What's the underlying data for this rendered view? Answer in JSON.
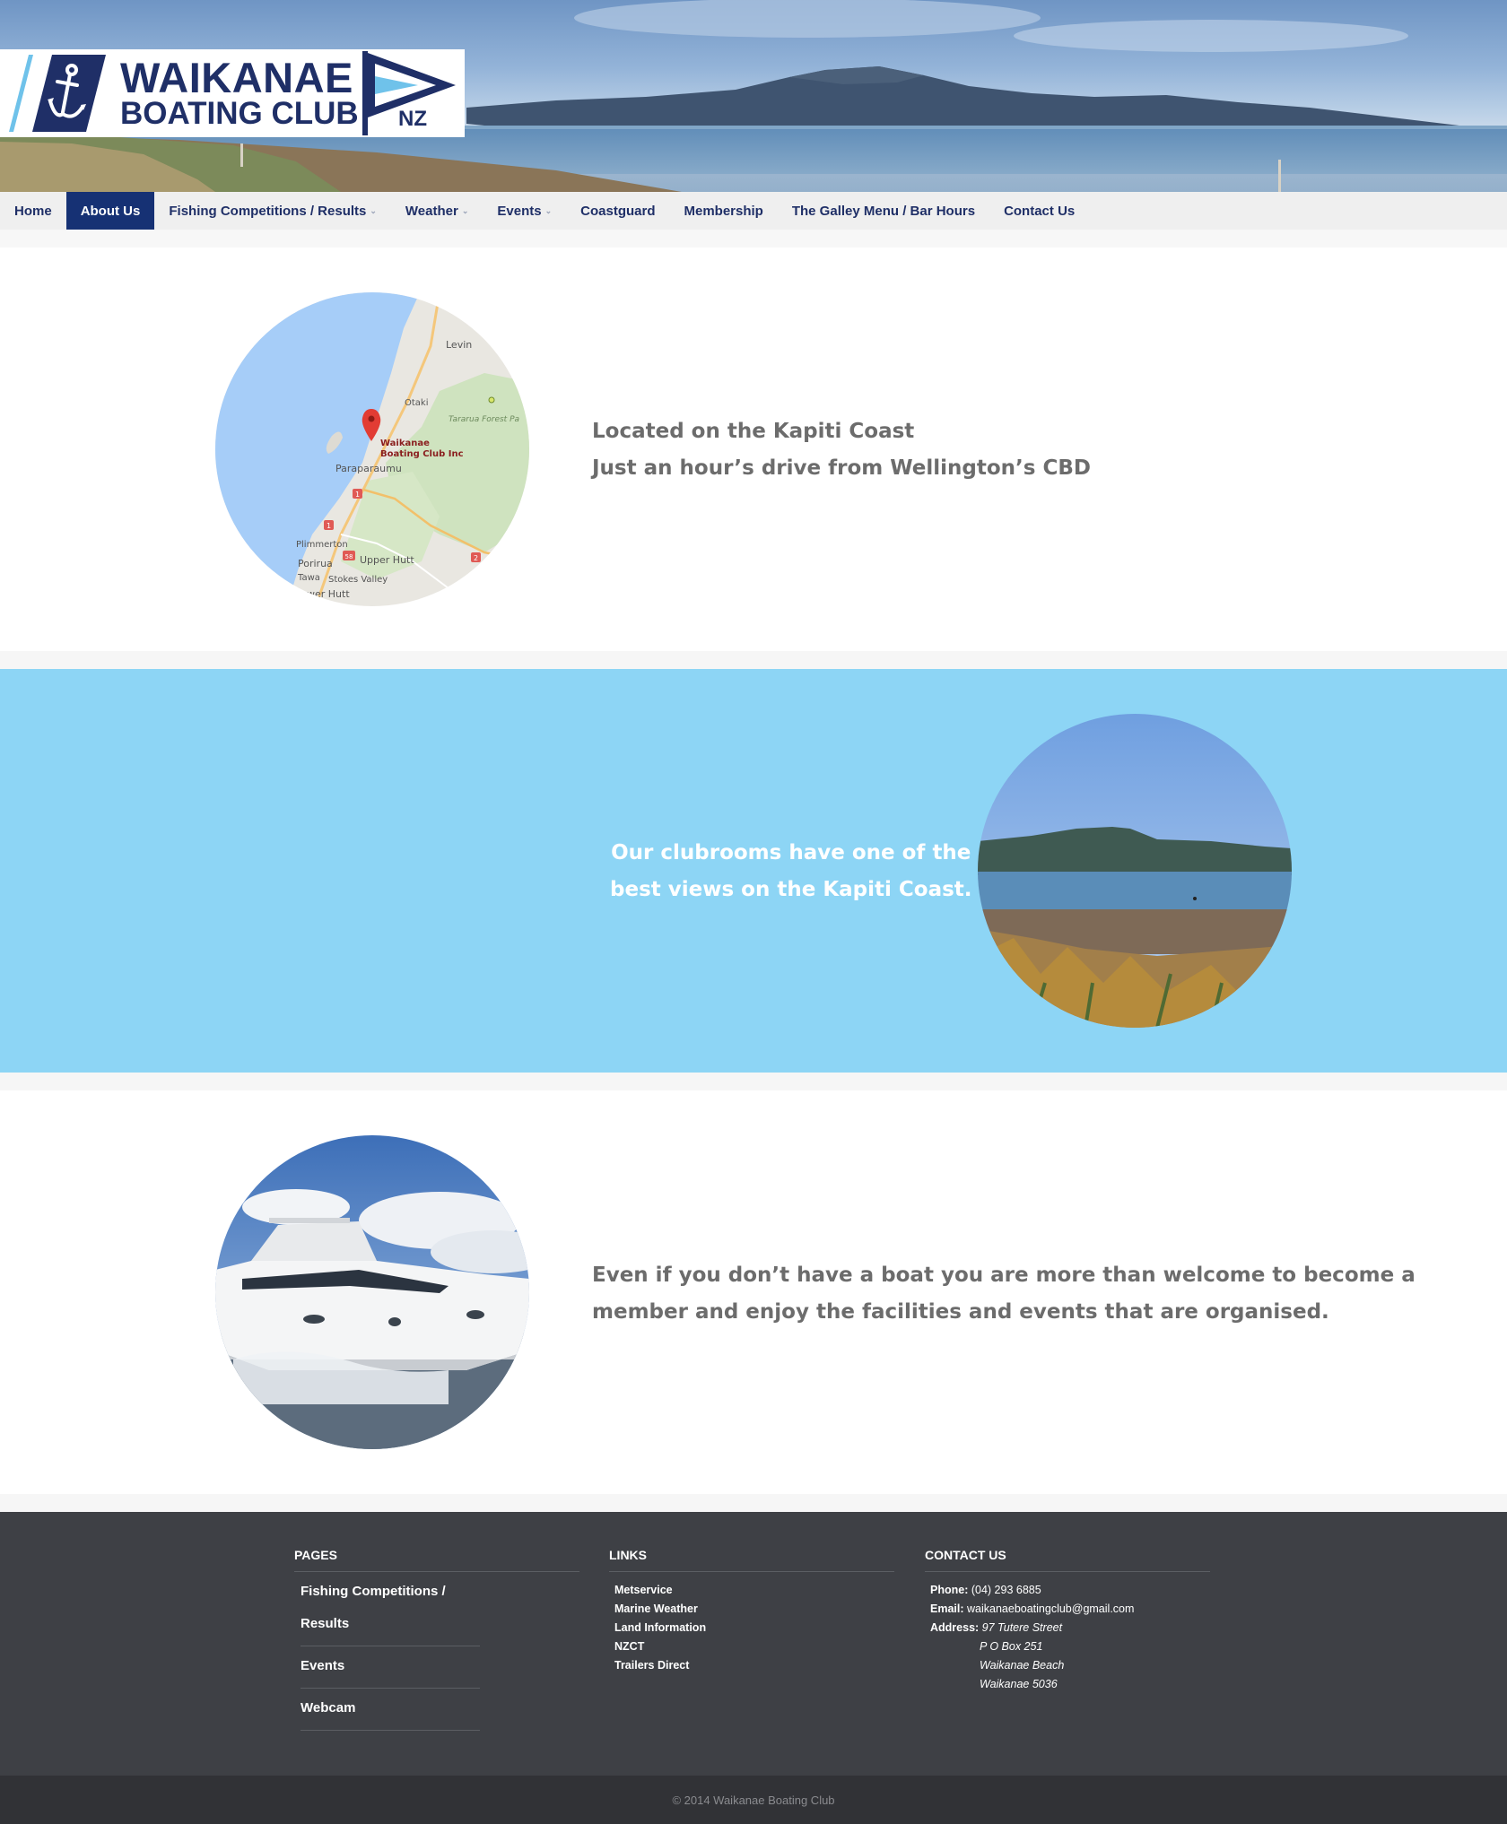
{
  "header": {
    "logo_line1": "WAIKANAE",
    "logo_line2": "BOATING CLUB",
    "logo_nz": "NZ"
  },
  "nav": {
    "items": [
      {
        "label": "Home"
      },
      {
        "label": "About Us",
        "active": true
      },
      {
        "label": "Fishing Competitions / Results",
        "caret": "⌄"
      },
      {
        "label": "Weather",
        "caret": "⌄"
      },
      {
        "label": "Events",
        "caret": "⌄"
      },
      {
        "label": "Coastguard"
      },
      {
        "label": "Membership"
      },
      {
        "label": "The Galley Menu / Bar Hours"
      },
      {
        "label": "Contact Us"
      }
    ]
  },
  "map": {
    "labels": [
      "Levin",
      "Otaki",
      "Tararua Forest Pa",
      "Waikanae",
      "Boating Club Inc",
      "Paraparaumu",
      "Plimmerton",
      "Porirua",
      "Upper Hutt",
      "Tawa",
      "Stokes Valley",
      "wer Hutt"
    ],
    "shields": [
      "1",
      "1",
      "58",
      "2"
    ]
  },
  "sections": {
    "s1": {
      "line1": "Located on the Kapiti Coast",
      "line2": "Just an hour’s drive from Wellington’s CBD"
    },
    "s2": {
      "line1": "Our clubrooms have one of the",
      "line2": "best views on the Kapiti Coast."
    },
    "s3": {
      "line1": "Even if you don’t have a boat you are more than welcome to become a",
      "line2": "member and enjoy the facilities and events that are organised."
    }
  },
  "colors": {
    "brand_navy": "#1f2f67",
    "nav_active": "#163174",
    "band_blue": "#8dd5f5",
    "footer_bg": "#3e4045"
  },
  "footer": {
    "pages": {
      "heading": "PAGES",
      "items": [
        "Fishing Competitions / Results",
        "Events",
        "Webcam"
      ]
    },
    "links": {
      "heading": "LINKS",
      "items": [
        "Metservice",
        "Marine Weather",
        "Land Information",
        "NZCT",
        "Trailers Direct"
      ]
    },
    "contact": {
      "heading": "CONTACT US",
      "phone_label": "Phone:",
      "phone": "(04) 293 6885",
      "email_label": "Email:",
      "email": "waikanaeboatingclub@gmail.com",
      "address_label": "Address:",
      "address": [
        "97 Tutere Street",
        "P O Box 251",
        "Waikanae Beach",
        "Waikanae 5036"
      ]
    },
    "copyright": "© 2014 Waikanae Boating Club"
  }
}
